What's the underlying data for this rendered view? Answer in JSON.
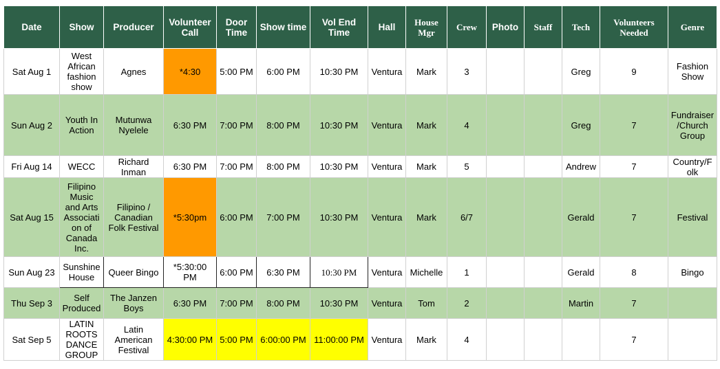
{
  "headers": {
    "date": "Date",
    "show": "Show",
    "producer": "Producer",
    "volunteer_call": "Volunteer Call",
    "door_time": "Door Time",
    "show_time": "Show time",
    "vol_end_time": "Vol End Time",
    "hall": "Hall",
    "house_mgr": "House Mgr",
    "crew": "Crew",
    "photo": "Photo",
    "staff": "Staff",
    "tech": "Tech",
    "volunteers_needed": "Volunteers Needed",
    "genre": "Genre"
  },
  "rows": [
    {
      "date": "Sat Aug 1",
      "show": "West African fashion show",
      "producer": "Agnes",
      "volunteer_call": "*4:30",
      "door_time": "5:00 PM",
      "show_time": "6:00 PM",
      "vol_end_time": "10:30 PM",
      "hall": "Ventura",
      "house_mgr": "Mark",
      "crew": "3",
      "photo": "",
      "staff": "",
      "tech": "Greg",
      "volunteers_needed": "9",
      "genre": "Fashion Show"
    },
    {
      "date": "Sun Aug 2",
      "show": "Youth In Action",
      "producer": "Mutunwa Nyelele",
      "volunteer_call": "6:30 PM",
      "door_time": "7:00 PM",
      "show_time": "8:00 PM",
      "vol_end_time": "10:30 PM",
      "hall": "Ventura",
      "house_mgr": "Mark",
      "crew": "4",
      "photo": "",
      "staff": "",
      "tech": "Greg",
      "volunteers_needed": "7",
      "genre": "Fundraiser /Church Group"
    },
    {
      "date": "Fri Aug 14",
      "show": "WECC",
      "producer": "Richard Inman",
      "volunteer_call": "6:30 PM",
      "door_time": "7:00 PM",
      "show_time": "8:00 PM",
      "vol_end_time": "10:30 PM",
      "hall": "Ventura",
      "house_mgr": "Mark",
      "crew": "5",
      "photo": "",
      "staff": "",
      "tech": "Andrew",
      "volunteers_needed": "7",
      "genre": "Country/F olk"
    },
    {
      "date": "Sat Aug 15",
      "show": "Filipino Music and Arts Associati on of Canada Inc.",
      "producer": "Filipino / Canadian Folk Festival",
      "volunteer_call": "*5:30pm",
      "door_time": "6:00 PM",
      "show_time": "7:00 PM",
      "vol_end_time": "10:30 PM",
      "hall": "Ventura",
      "house_mgr": "Mark",
      "crew": "6/7",
      "photo": "",
      "staff": "",
      "tech": "Gerald",
      "volunteers_needed": "7",
      "genre": "Festival"
    },
    {
      "date": "Sun Aug 23",
      "show": "Sunshine House",
      "producer": "Queer Bingo",
      "volunteer_call": "*5:30:00 PM",
      "door_time": "6:00 PM",
      "show_time": "6:30 PM",
      "vol_end_time": "10:30 PM",
      "hall": "Ventura",
      "house_mgr": "Michelle",
      "crew": "1",
      "photo": "",
      "staff": "",
      "tech": "Gerald",
      "volunteers_needed": "8",
      "genre": "Bingo"
    },
    {
      "date": "Thu Sep 3",
      "show": "Self Produced",
      "producer": "The Janzen Boys",
      "volunteer_call": "6:30 PM",
      "door_time": "7:00 PM",
      "show_time": "8:00 PM",
      "vol_end_time": "10:30 PM",
      "hall": "Ventura",
      "house_mgr": "Tom",
      "crew": "2",
      "photo": "",
      "staff": "",
      "tech": "Martin",
      "volunteers_needed": "7",
      "genre": ""
    },
    {
      "date": "Sat Sep 5",
      "show": "LATIN ROOTS DANCE GROUP",
      "producer": "Latin American Festival",
      "volunteer_call": "4:30:00 PM",
      "door_time": "5:00 PM",
      "show_time": "6:00:00 PM",
      "vol_end_time": "11:00:00 PM",
      "hall": "Ventura",
      "house_mgr": "Mark",
      "crew": "4",
      "photo": "",
      "staff": "",
      "tech": "",
      "volunteers_needed": "7",
      "genre": ""
    }
  ],
  "colors": {
    "header_bg": "#2e6048",
    "row_green": "#b7d7a8",
    "highlight_orange": "#ff9900",
    "highlight_yellow": "#ffff00"
  }
}
